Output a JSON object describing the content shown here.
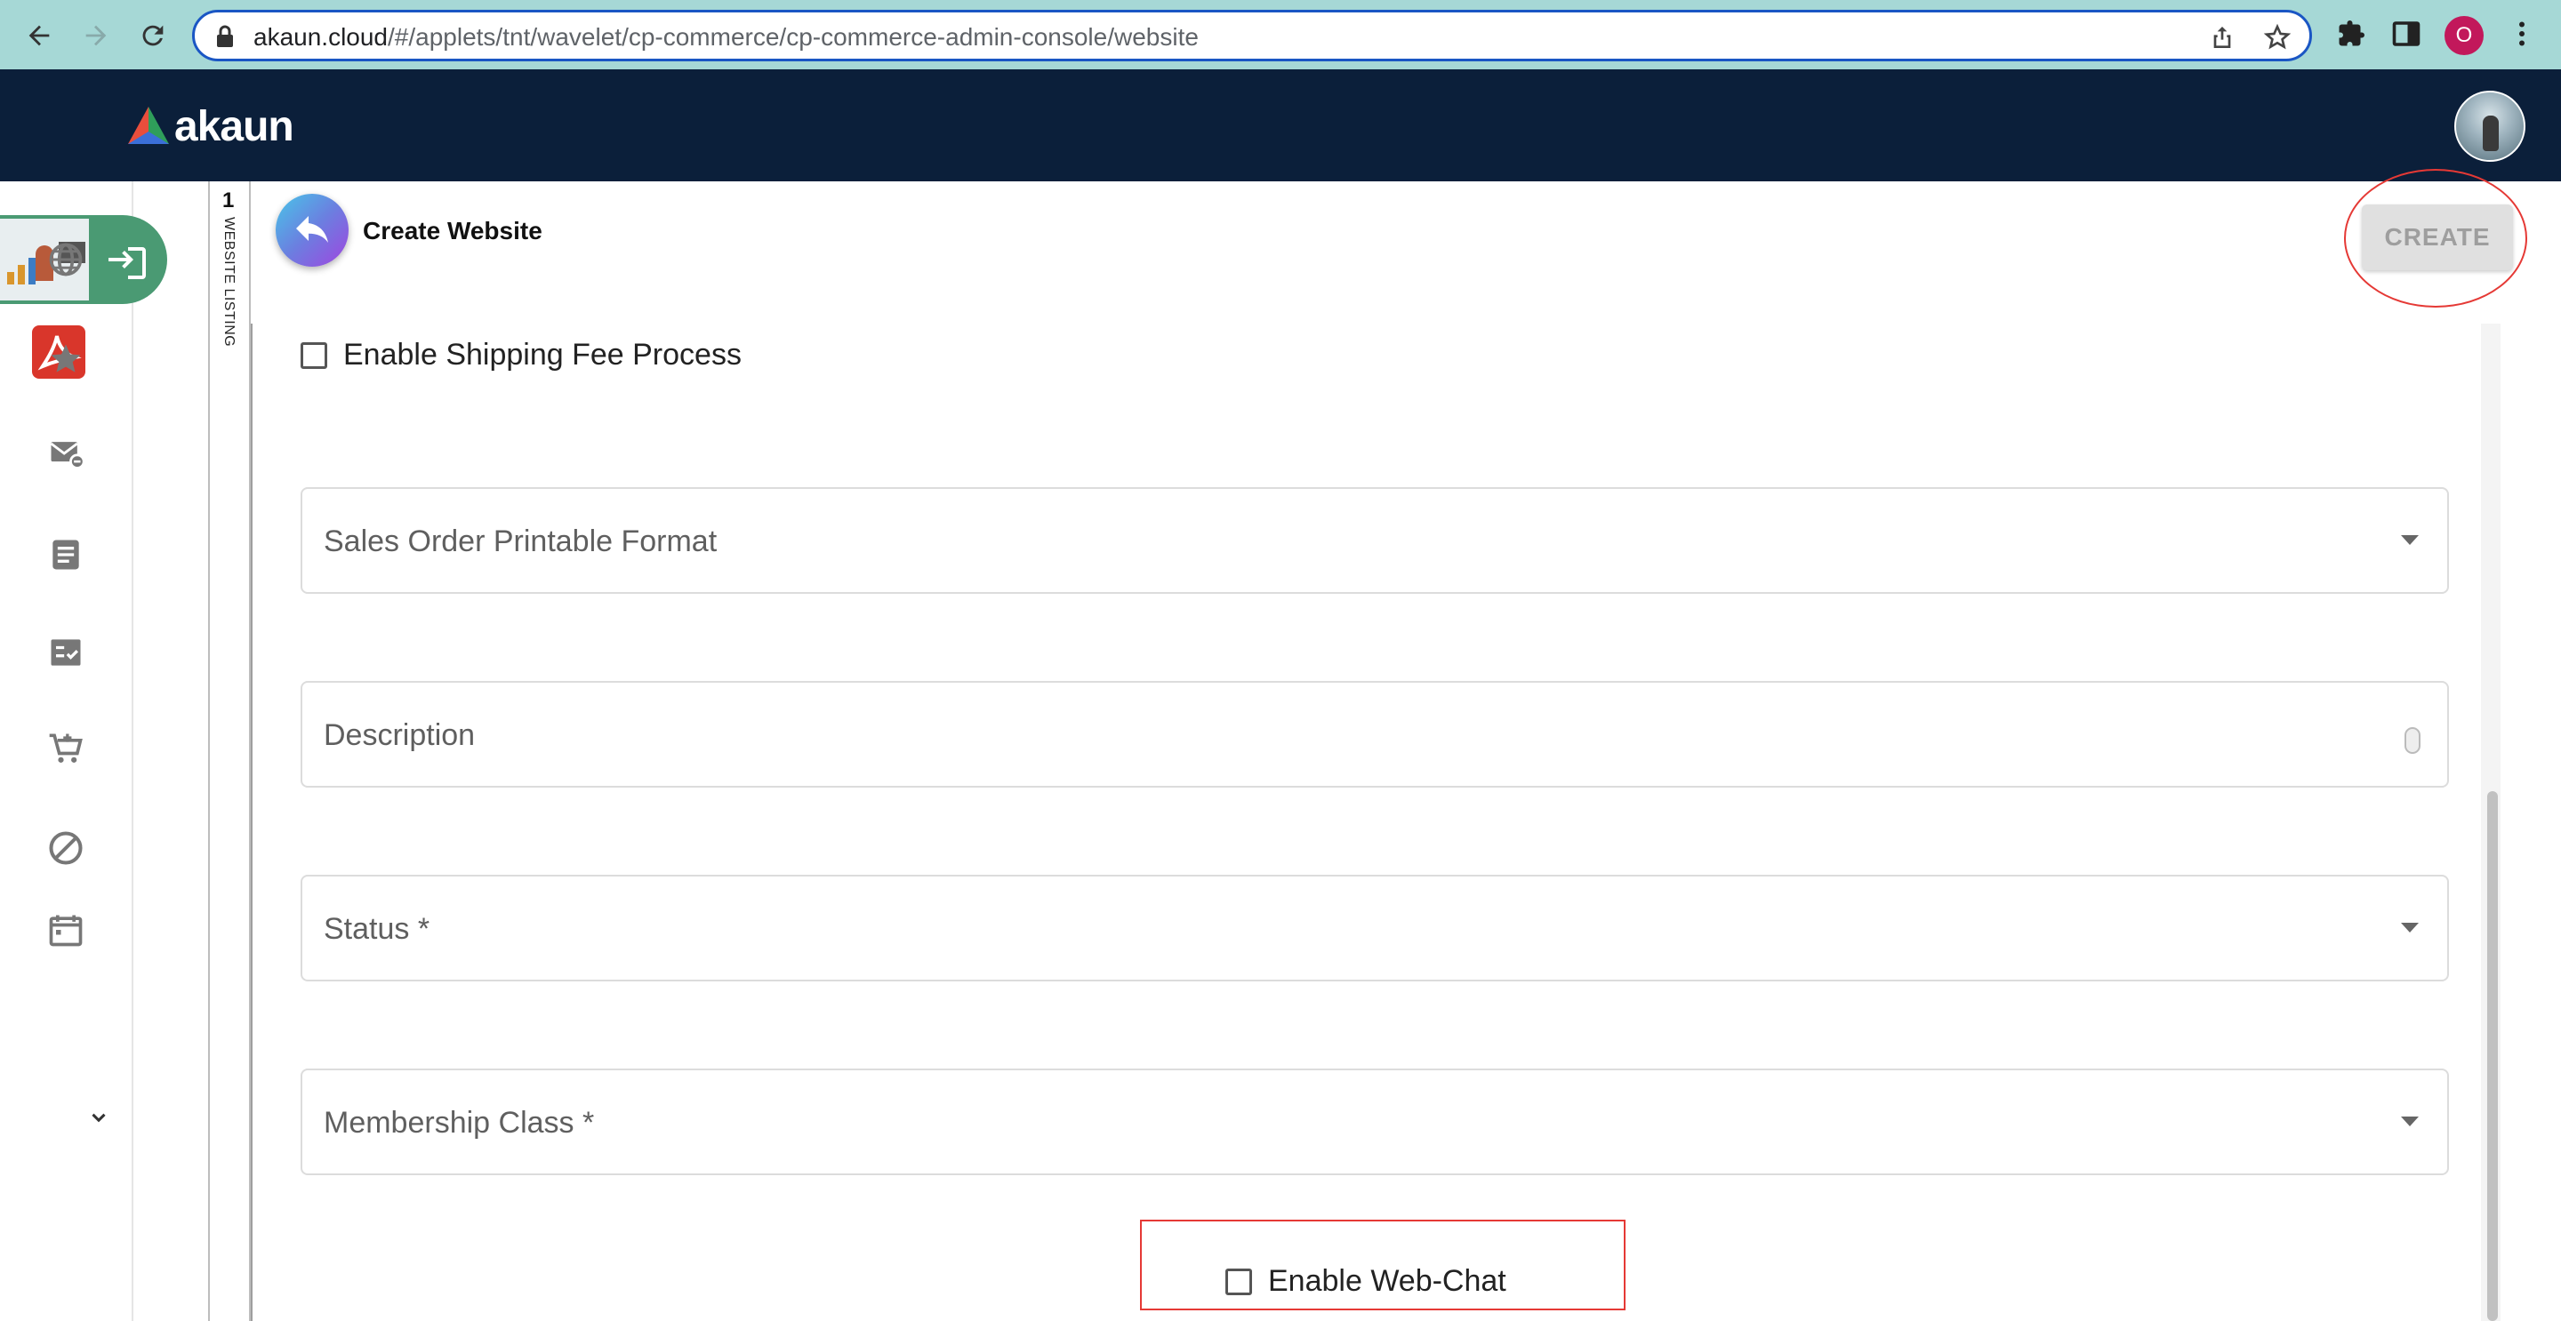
{
  "browser": {
    "url_host": "akaun.cloud",
    "url_path": "/#/applets/tnt/wavelet/cp-commerce/cp-commerce-admin-console/website",
    "profile_initial": "O"
  },
  "app": {
    "brand": "akaun"
  },
  "sidebar": {
    "items": [
      {
        "icon": "globe-icon"
      },
      {
        "icon": "star-icon"
      },
      {
        "icon": "mail-icon"
      },
      {
        "icon": "document-icon"
      },
      {
        "icon": "checklist-icon"
      },
      {
        "icon": "cart-icon"
      },
      {
        "icon": "block-icon"
      },
      {
        "icon": "calendar-icon"
      }
    ]
  },
  "tabs": {
    "count": "1",
    "label": "WEBSITE LISTING"
  },
  "panel": {
    "title": "Create Website",
    "create_label": "CREATE"
  },
  "form": {
    "enable_shipping_label": "Enable Shipping Fee Process",
    "sales_order_format_label": "Sales Order Printable Format",
    "description_label": "Description",
    "status_label": "Status *",
    "membership_class_label": "Membership Class *",
    "enable_webchat_label": "Enable Web-Chat"
  },
  "colors": {
    "appbar": "#0b1f3a",
    "chrome": "#a6d8d6",
    "active_item": "#4a9a73",
    "highlight": "#e53935"
  }
}
